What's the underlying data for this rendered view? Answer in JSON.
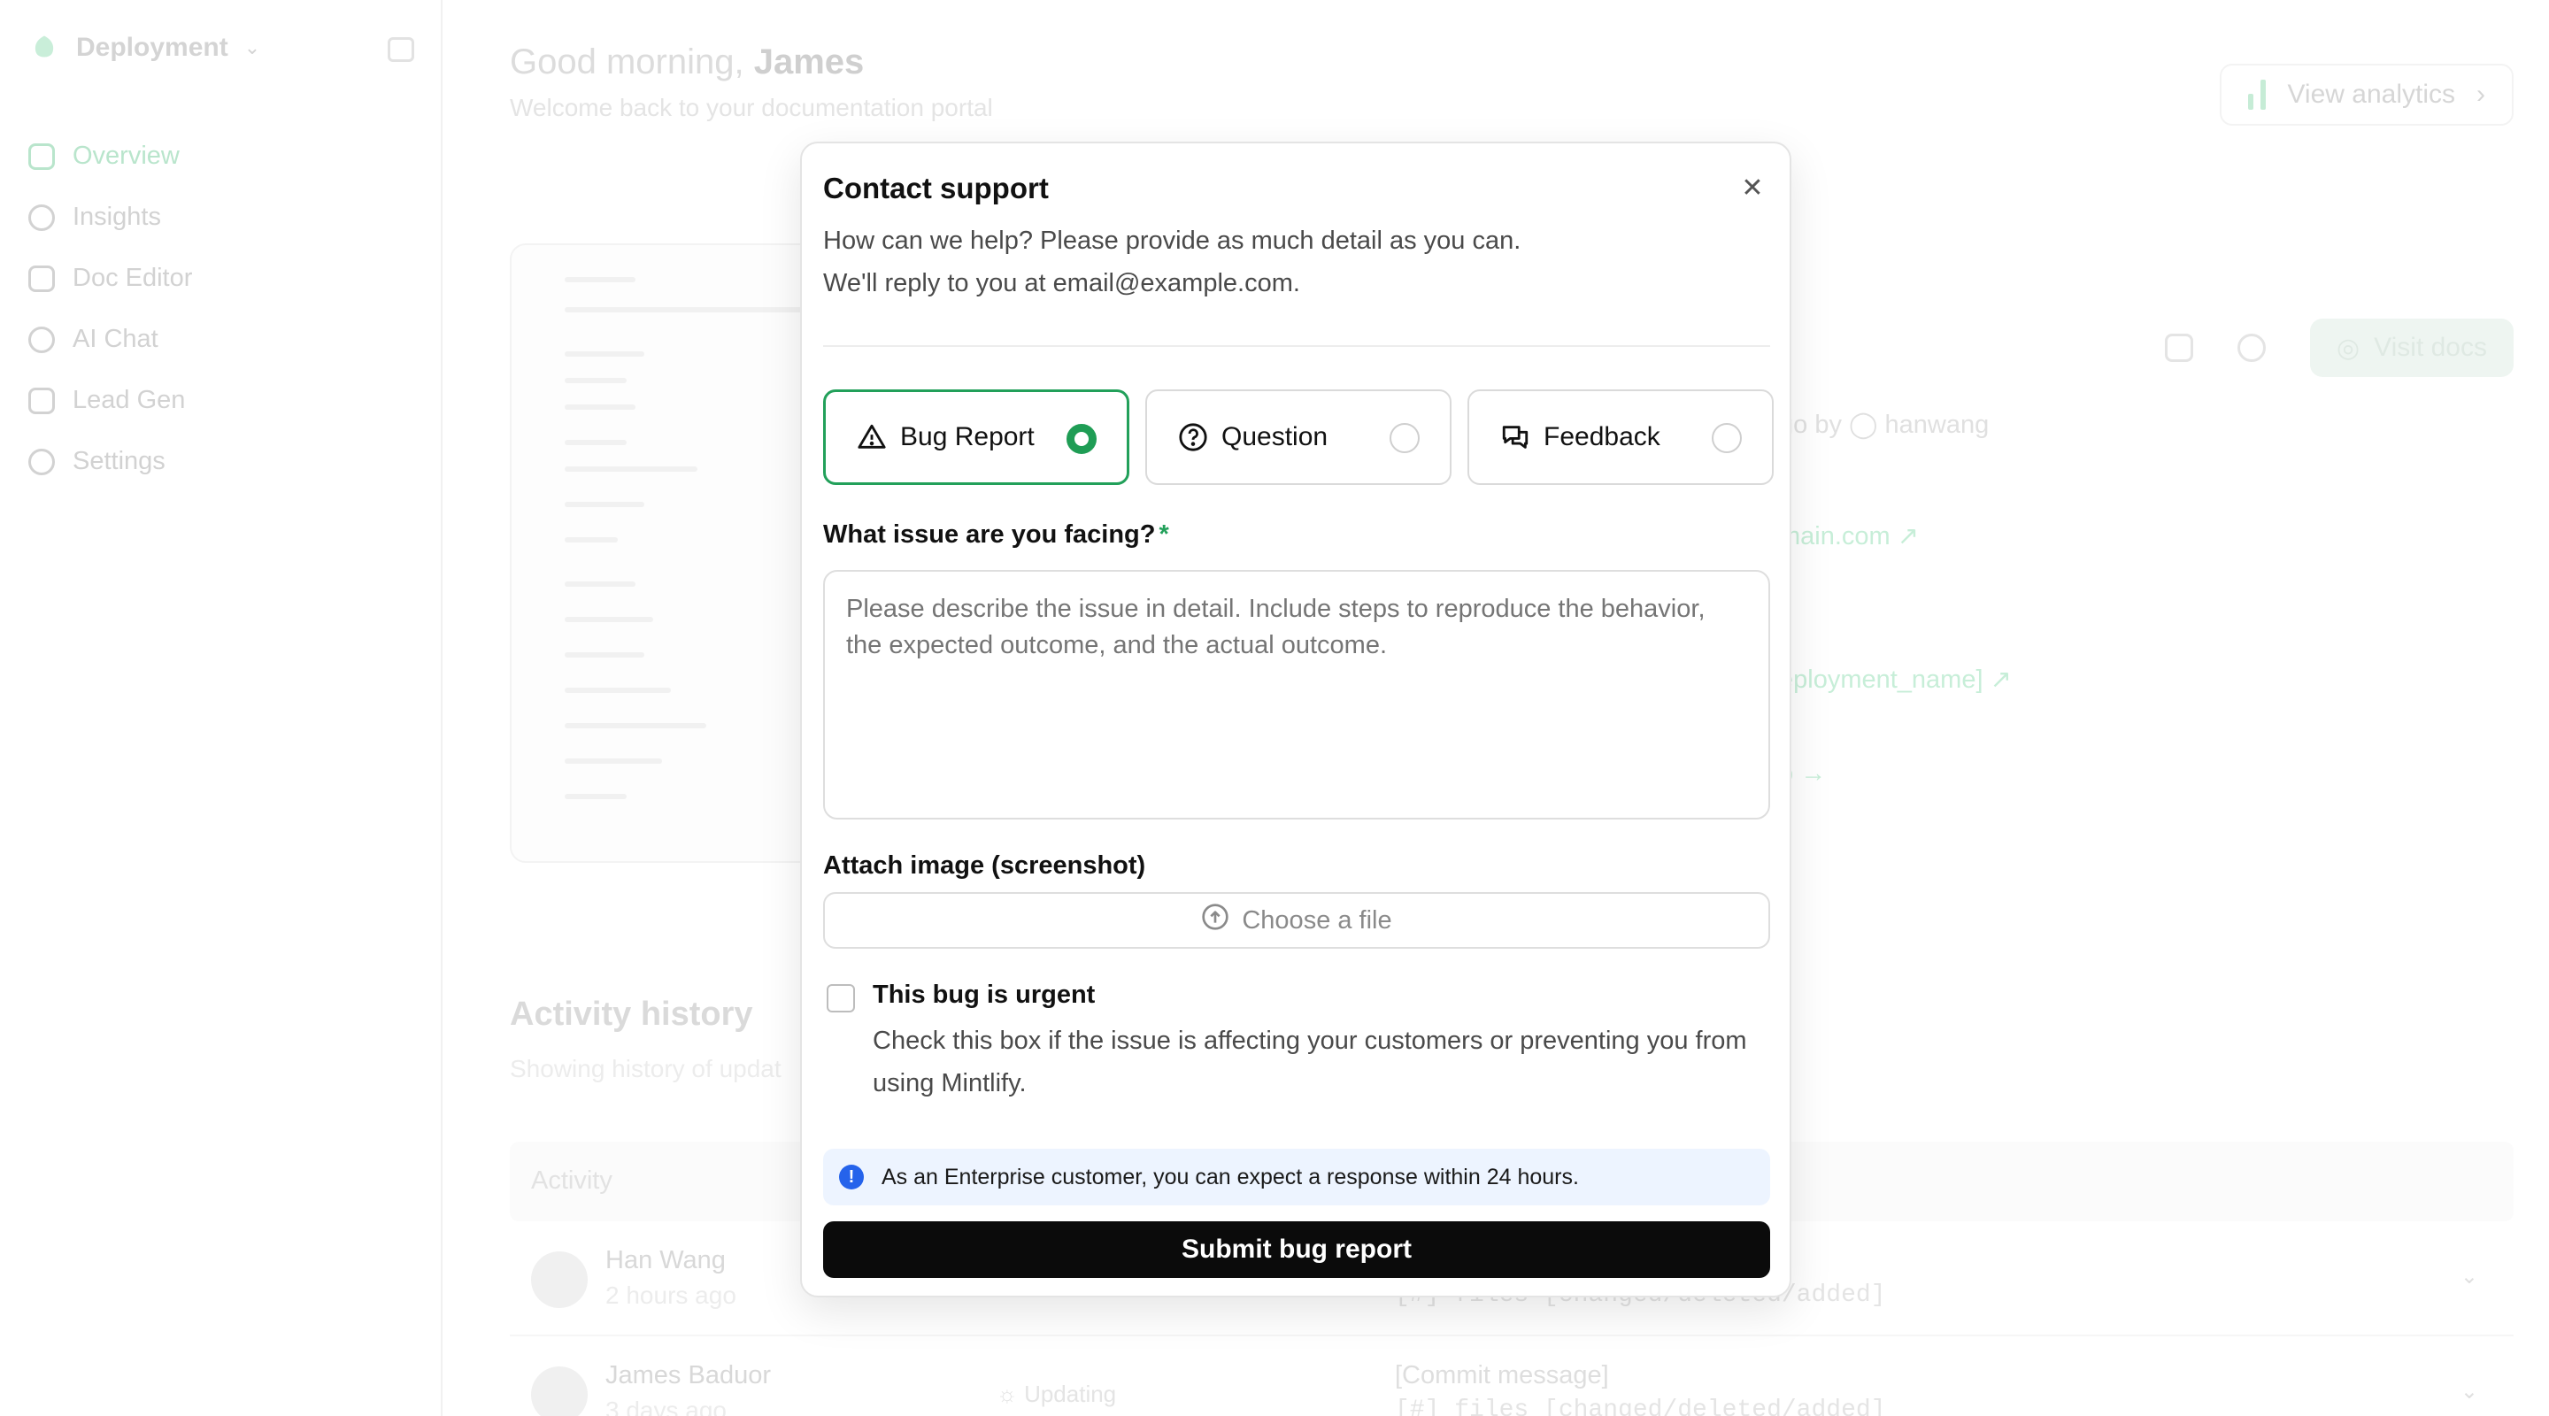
{
  "sidebar": {
    "project_name": "Deployment",
    "items": [
      {
        "label": "Overview",
        "icon": "home-icon"
      },
      {
        "label": "Insights",
        "icon": "chart-icon"
      },
      {
        "label": "Doc Editor",
        "icon": "document-icon"
      },
      {
        "label": "AI Chat",
        "icon": "chat-icon"
      },
      {
        "label": "Lead Gen",
        "icon": "briefcase-icon"
      },
      {
        "label": "Settings",
        "icon": "gear-icon"
      }
    ]
  },
  "header": {
    "greeting": "Good morning,",
    "user": "James",
    "subtitle": "Welcome back to your documentation portal",
    "analytics_label": "View analytics"
  },
  "deployment": {
    "visit_docs_label": "Visit docs",
    "updated_by_text": "go by",
    "updated_by_user": "hanwang",
    "domain_text": "main.com",
    "deployment_name_text": "eployment_name]",
    "arrow_link": "o"
  },
  "activity": {
    "title": "Activity history",
    "subtitle": "Showing history of updat",
    "column_header": "Activity",
    "rows": [
      {
        "name": "Han Wang",
        "time": "2 hours ago",
        "status": "",
        "message": "",
        "files": "[#] files [changed/deleted/added]"
      },
      {
        "name": "James Baduor",
        "time": "3 days ago",
        "status": "Updating",
        "message": "[Commit message]",
        "files": "[#] files [changed/deleted/added]"
      }
    ]
  },
  "modal": {
    "title": "Contact support",
    "description_line1": "How can we help? Please provide as much detail as you can.",
    "description_line2": "We'll reply to you at email@example.com.",
    "types": [
      {
        "label": "Bug Report",
        "icon": "warning-triangle-icon",
        "selected": true
      },
      {
        "label": "Question",
        "icon": "question-circle-icon",
        "selected": false
      },
      {
        "label": "Feedback",
        "icon": "chat-bubbles-icon",
        "selected": false
      }
    ],
    "issue_label": "What issue are you facing?",
    "required_mark": "*",
    "issue_placeholder": "Please describe the issue in detail. Include steps to reproduce the behavior, the expected outcome, and the actual outcome.",
    "attach_label": "Attach image (screenshot)",
    "choose_file_label": "Choose a file",
    "urgent_label": "This bug is urgent",
    "urgent_description": "Check this box if the issue is affecting your customers or preventing you from using Mintlify.",
    "notice_text": "As an Enterprise customer, you can expect a response within 24 hours.",
    "submit_label": "Submit bug report"
  },
  "colors": {
    "accent": "#1f9d55",
    "info": "#2563eb",
    "submit_bg": "#0b0b0b"
  }
}
